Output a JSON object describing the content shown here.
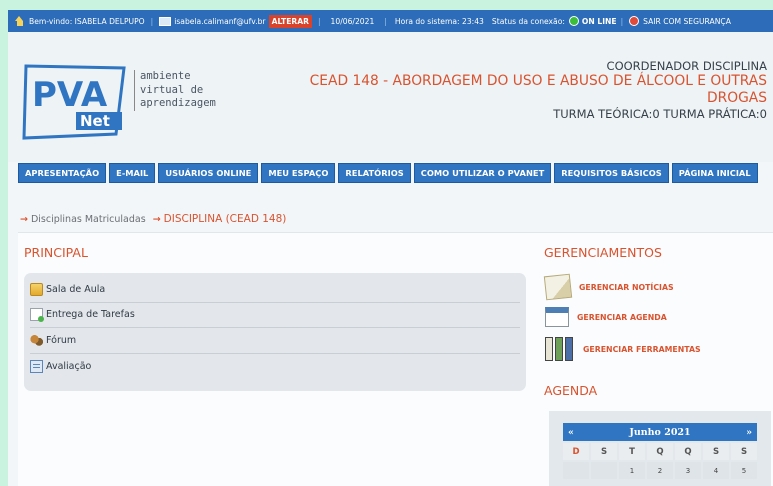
{
  "topbar": {
    "welcome": "Bem-vindo: ISABELA DELPUPO",
    "email": "isabela.calimanf@ufv.br",
    "alter_label": "ALTERAR",
    "date": "10/06/2021",
    "system_time": "Hora do sistema: 23:43",
    "connection_label": "Status da conexão:",
    "connection_status": "ON LINE",
    "logout_label": "SAIR COM SEGURANÇA"
  },
  "brand": {
    "logo_main": "PVA",
    "logo_net": "Net",
    "tag_line1": "ambiente",
    "tag_line2": "virtual de",
    "tag_line3": "aprendizagem"
  },
  "header": {
    "role": "COORDENADOR DISCIPLINA",
    "course_title": "CEAD 148 - ABORDAGEM DO USO E ABUSO DE ÁLCOOL E OUTRAS DROGAS",
    "turma": "TURMA TEÓRICA:0 TURMA PRÁTICA:0"
  },
  "nav": [
    "APRESENTAÇÃO",
    "E-MAIL",
    "USUÁRIOS ONLINE",
    "MEU ESPAÇO",
    "RELATÓRIOS",
    "COMO UTILIZAR O PVANET",
    "REQUISITOS BÁSICOS",
    "PÁGINA INICIAL"
  ],
  "breadcrumb": {
    "parent": "Disciplinas Matriculadas",
    "current": "DISCIPLINA (CEAD 148)"
  },
  "principal": {
    "title": "PRINCIPAL",
    "items": [
      "Sala de Aula",
      "Entrega de Tarefas",
      "Fórum",
      "Avaliação"
    ]
  },
  "gerenciamentos": {
    "title": "GERENCIAMENTOS",
    "items": [
      "GERENCIAR NOTÍCIAS",
      "GERENCIAR AGENDA",
      "GERENCIAR FERRAMENTAS"
    ]
  },
  "agenda": {
    "title": "AGENDA",
    "prev": "«",
    "next": "»",
    "month": "Junho  2021",
    "weekdays": [
      "D",
      "S",
      "T",
      "Q",
      "Q",
      "S",
      "S"
    ],
    "first_row": [
      "",
      "",
      "1",
      "2",
      "3",
      "4",
      "5"
    ]
  },
  "colors": {
    "accent": "#d9532f",
    "nav_blue": "#2f75c2",
    "topbar_blue": "#2c6cb8",
    "online_green": "#3bbf3b"
  }
}
